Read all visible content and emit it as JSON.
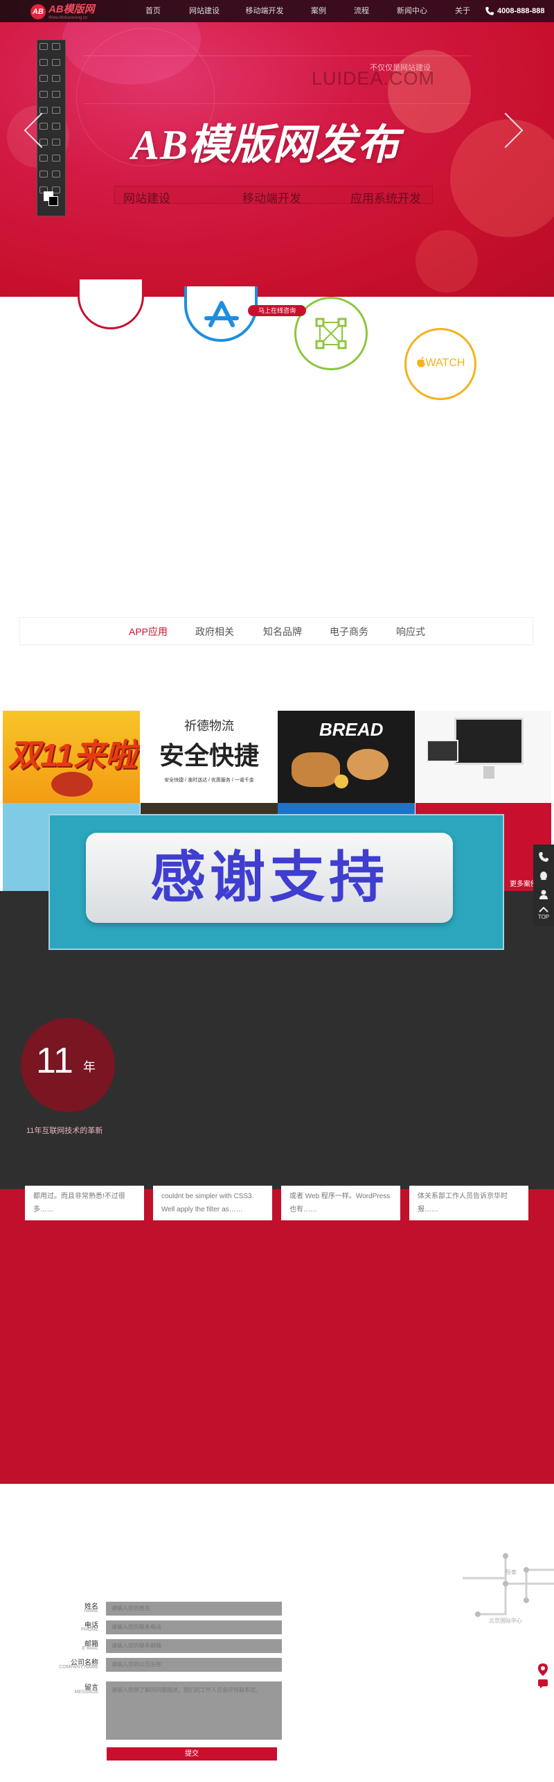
{
  "header": {
    "logo_mark": "AB",
    "logo_text": "AB模版网",
    "logo_sub": "Www.Mobanwang.cn",
    "nav": [
      "首页",
      "网站建设",
      "移动端开发",
      "案例",
      "流程",
      "新闻中心",
      "关于"
    ],
    "phone": "4008-888-888",
    "phone_icon": "phone-icon"
  },
  "banner": {
    "tagline": "不仅仅是网站建设",
    "brand": "LUIDEA.COM",
    "title": "AB模版网发布",
    "services": [
      "网站建设",
      "移动端开发",
      "应用系统开发"
    ]
  },
  "icons_section": {
    "consult_button": "马上在线咨询",
    "watch_label": "WATCH"
  },
  "tabs": [
    "APP应用",
    "政府相关",
    "知名品牌",
    "电子商务",
    "响应式"
  ],
  "tabs_active_index": 0,
  "portfolio": {
    "cell1_text": "双11来啦",
    "cell2_top": "祈德物流",
    "cell2_main": "安全快捷",
    "cell2_sub": "安全快捷 / 准时送达 / 优质服务 / 一诺千金",
    "cell3_text": "BREAD",
    "overlay_text": "感谢支持",
    "more_button": "更多案例"
  },
  "stats": {
    "number": "11",
    "unit": "年",
    "caption": "11年互联网技术的革新"
  },
  "news_cards": [
    "都用过。而且非常熟悉!不过很多……",
    "couldnt be simpler with CSS3. Well apply the filter as……",
    "或者 Web 程序一样。WordPress 也有……",
    "体关系部工作人员告诉京华时报……"
  ],
  "side_float": {
    "top_label": "TOP"
  },
  "contact": {
    "fields": [
      {
        "label": "姓名",
        "sub": "NAME",
        "placeholder": "请输入您的姓名"
      },
      {
        "label": "电话",
        "sub": "PHONE",
        "placeholder": "请输入您的联系电话"
      },
      {
        "label": "邮箱",
        "sub": "E-MAIL",
        "placeholder": "请输入您的联系邮箱"
      },
      {
        "label": "公司名称",
        "sub": "COMPANY NAME",
        "placeholder": "请输入您的公司名称"
      },
      {
        "label": "留言",
        "sub": "MESSAGE",
        "placeholder": "请输入您想了解的问题描述，我们的工作人员会尽快联系您。"
      }
    ],
    "submit": "提交",
    "map_label1": "恒泰",
    "map_label2": "北京国际中心"
  },
  "colors": {
    "brand_red": "#c8102e",
    "dark_band": "#2f2f2f"
  }
}
